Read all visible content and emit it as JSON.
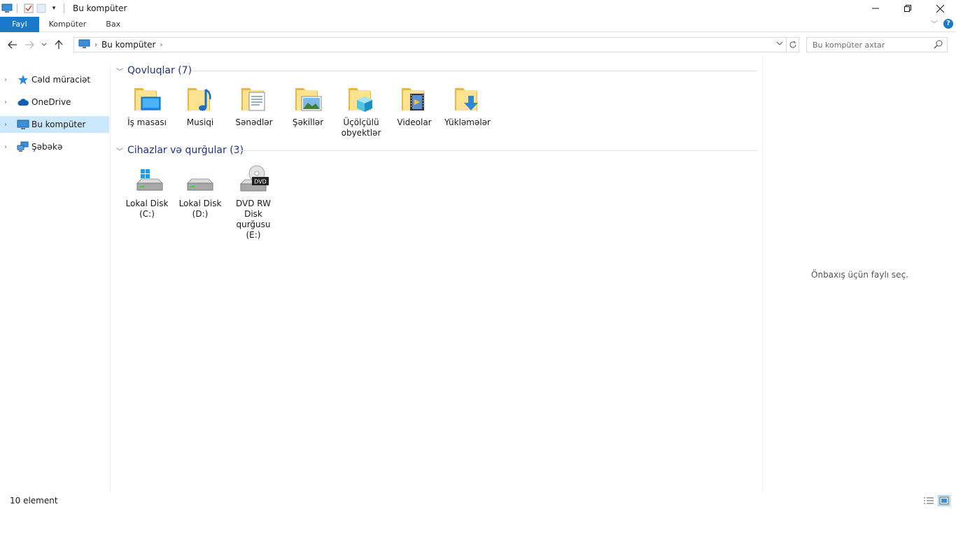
{
  "window": {
    "title": "Bu kompüter"
  },
  "ribbon": {
    "tabs": [
      "Fayl",
      "Kompüter",
      "Bax"
    ]
  },
  "address": {
    "location": "Bu kompüter"
  },
  "search": {
    "placeholder": "Bu kompüter axtar"
  },
  "nav_pane": {
    "items": [
      {
        "label": "Cəld müraciət",
        "icon": "star-icon"
      },
      {
        "label": "OneDrive",
        "icon": "cloud-icon"
      },
      {
        "label": "Bu kompüter",
        "icon": "computer-icon",
        "selected": true
      },
      {
        "label": "Şəbəkə",
        "icon": "network-icon"
      }
    ]
  },
  "groups": {
    "folders": {
      "title": "Qovluqlar (7)",
      "items": [
        {
          "label": "İş masası",
          "icon": "desktop-folder-icon"
        },
        {
          "label": "Musiqi",
          "icon": "music-folder-icon"
        },
        {
          "label": "Sənədlər",
          "icon": "documents-folder-icon"
        },
        {
          "label": "Şəkillər",
          "icon": "pictures-folder-icon"
        },
        {
          "label": "Üçölçülü obyektlər",
          "icon": "3d-objects-folder-icon"
        },
        {
          "label": "Videolar",
          "icon": "videos-folder-icon"
        },
        {
          "label": "Yükləmələr",
          "icon": "downloads-folder-icon"
        }
      ]
    },
    "devices": {
      "title": "Cihazlar və qurğular (3)",
      "items": [
        {
          "label": "Lokal Disk (C:)",
          "icon": "system-drive-icon"
        },
        {
          "label": "Lokal Disk (D:)",
          "icon": "drive-icon"
        },
        {
          "label": "DVD RW Disk qurğusu (E:)",
          "icon": "dvd-drive-icon",
          "badge": "DVD"
        }
      ]
    }
  },
  "preview": {
    "text": "Önbaxış üçün faylı seç."
  },
  "status": {
    "count_text": "10 element"
  },
  "colors": {
    "accent": "#1979ca",
    "selection": "#cce8ff",
    "group_title": "#1e3287"
  }
}
